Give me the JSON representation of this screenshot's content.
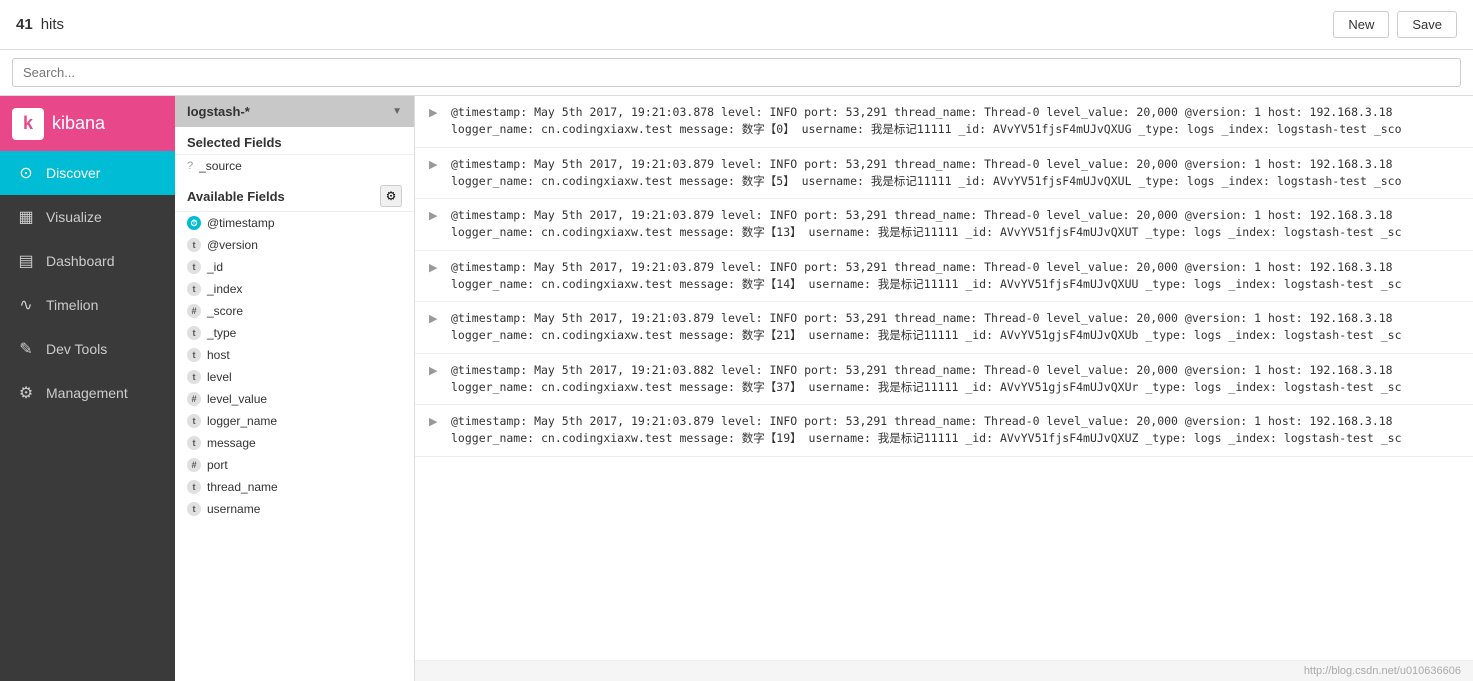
{
  "topbar": {
    "hits_count": "41",
    "hits_label": "hits",
    "btn_new": "New",
    "btn_save": "Save"
  },
  "search": {
    "placeholder": "Search..."
  },
  "sidebar": {
    "logo_text": "kibana",
    "items": [
      {
        "id": "discover",
        "label": "Discover",
        "icon": "○"
      },
      {
        "id": "visualize",
        "label": "Visualize",
        "icon": "▦"
      },
      {
        "id": "dashboard",
        "label": "Dashboard",
        "icon": "▤"
      },
      {
        "id": "timelion",
        "label": "Timelion",
        "icon": "~"
      },
      {
        "id": "devtools",
        "label": "Dev Tools",
        "icon": "✎"
      },
      {
        "id": "management",
        "label": "Management",
        "icon": "⚙"
      }
    ]
  },
  "leftpanel": {
    "index_pattern": "logstash-*",
    "selected_fields_title": "Selected Fields",
    "source_field": "_source",
    "available_fields_title": "Available Fields",
    "fields": [
      {
        "name": "@timestamp",
        "type": "clock"
      },
      {
        "name": "@version",
        "type": "t"
      },
      {
        "name": "_id",
        "type": "t"
      },
      {
        "name": "_index",
        "type": "t"
      },
      {
        "name": "_score",
        "type": "hash"
      },
      {
        "name": "_type",
        "type": "t"
      },
      {
        "name": "host",
        "type": "t"
      },
      {
        "name": "level",
        "type": "t"
      },
      {
        "name": "level_value",
        "type": "hash"
      },
      {
        "name": "logger_name",
        "type": "t"
      },
      {
        "name": "message",
        "type": "t"
      },
      {
        "name": "port",
        "type": "hash"
      },
      {
        "name": "thread_name",
        "type": "t"
      },
      {
        "name": "username",
        "type": "t"
      }
    ]
  },
  "results": {
    "source_label": "_source",
    "rows": [
      {
        "line1": "@timestamp: May 5th 2017, 19:21:03.878  level: INFO  port: 53,291  thread_name: Thread-0  level_value: 20,000  @version: 1  host: 192.168.3.18",
        "line2": "logger_name: cn.codingxiaxw.test  message: 数字【0】  username: 我是标记11111  _id: AVvYV51fjsF4mUJvQXUG  _type: logs  _index: logstash-test  _sco"
      },
      {
        "line1": "@timestamp: May 5th 2017, 19:21:03.879  level: INFO  port: 53,291  thread_name: Thread-0  level_value: 20,000  @version: 1  host: 192.168.3.18",
        "line2": "logger_name: cn.codingxiaxw.test  message: 数字【5】  username: 我是标记11111  _id: AVvYV51fjsF4mUJvQXUL  _type: logs  _index: logstash-test  _sco"
      },
      {
        "line1": "@timestamp: May 5th 2017, 19:21:03.879  level: INFO  port: 53,291  thread_name: Thread-0  level_value: 20,000  @version: 1  host: 192.168.3.18",
        "line2": "logger_name: cn.codingxiaxw.test  message: 数字【13】  username: 我是标记11111  _id: AVvYV51fjsF4mUJvQXUT  _type: logs  _index: logstash-test  _sc"
      },
      {
        "line1": "@timestamp: May 5th 2017, 19:21:03.879  level: INFO  port: 53,291  thread_name: Thread-0  level_value: 20,000  @version: 1  host: 192.168.3.18",
        "line2": "logger_name: cn.codingxiaxw.test  message: 数字【14】  username: 我是标记11111  _id: AVvYV51fjsF4mUJvQXUU  _type: logs  _index: logstash-test  _sc"
      },
      {
        "line1": "@timestamp: May 5th 2017, 19:21:03.879  level: INFO  port: 53,291  thread_name: Thread-0  level_value: 20,000  @version: 1  host: 192.168.3.18",
        "line2": "logger_name: cn.codingxiaxw.test  message: 数字【21】  username: 我是标记11111  _id: AVvYV51gjsF4mUJvQXUb  _type: logs  _index: logstash-test  _sc"
      },
      {
        "line1": "@timestamp: May 5th 2017, 19:21:03.882  level: INFO  port: 53,291  thread_name: Thread-0  level_value: 20,000  @version: 1  host: 192.168.3.18",
        "line2": "logger_name: cn.codingxiaxw.test  message: 数字【37】  username: 我是标记11111  _id: AVvYV51gjsF4mUJvQXUr  _type: logs  _index: logstash-test  _sc"
      },
      {
        "line1": "@timestamp: May 5th 2017, 19:21:03.879  level: INFO  port: 53,291  thread_name: Thread-0  level_value: 20,000  @version: 1  host: 192.168.3.18",
        "line2": "logger_name: cn.codingxiaxw.test  message: 数字【19】  username: 我是标记11111  _id: AVvYV51fjsF4mUJvQXUZ  _type: logs  _index: logstash-test  _sc"
      }
    ]
  },
  "watermark": "http://blog.csdn.net/u010636606"
}
